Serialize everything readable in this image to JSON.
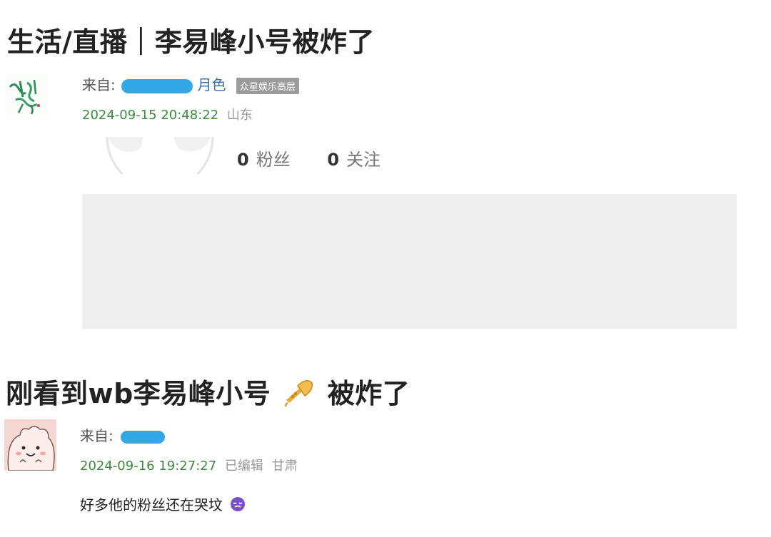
{
  "post1": {
    "title": "生活/直播｜李易峰小号被炸了",
    "from_prefix": "来自:",
    "source_tail": "月色",
    "badge": "众星娱乐高层",
    "timestamp": "2024-09-15 20:48:22",
    "location": "山东",
    "fans_count": "0",
    "fans_label": "粉丝",
    "follow_count": "0",
    "follow_label": "关注"
  },
  "post2": {
    "title_part1": "刚看到wb李易峰小号",
    "title_part2": "被炸了",
    "from_prefix": "来自:",
    "timestamp": "2024-09-16 19:27:27",
    "edited": "已编辑",
    "location": "甘肃",
    "body": "好多他的粉丝还在哭坟"
  },
  "icons": {
    "title_emoji": "trumpet-icon",
    "body_emoji": "crying-face-icon",
    "trumpet_color": "#e8a93a",
    "emoji_color": "#7a4fc9"
  },
  "colors": {
    "timestamp": "#3c8a3c",
    "link": "#3a6fb0",
    "redaction": "#29a3e6",
    "content_box": "#efefef"
  }
}
